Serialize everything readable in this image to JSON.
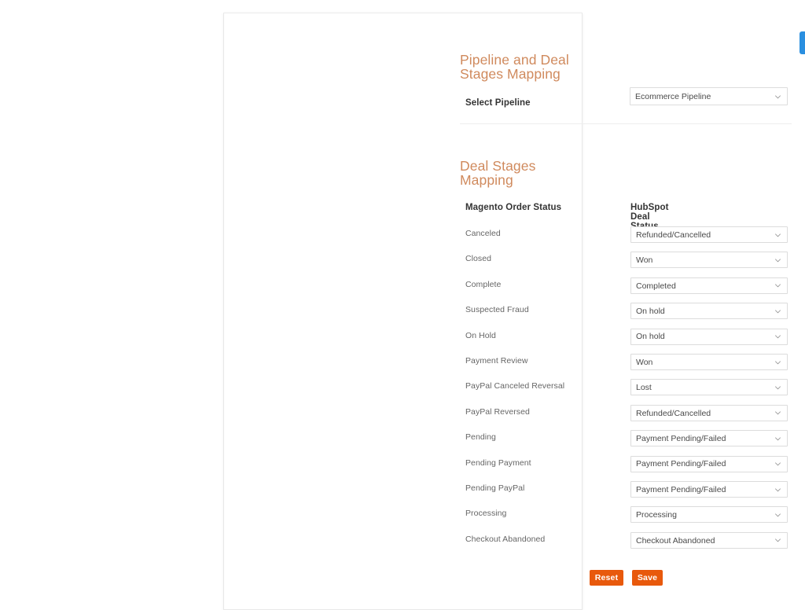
{
  "page": {
    "background": "#ffffff",
    "accent_heading_color": "#d08a5d",
    "button_color": "#e8590c",
    "edge_tab_color": "#2a8fe0"
  },
  "pipeline_section": {
    "title": "Pipeline and Deal Stages Mapping",
    "label": "Select Pipeline",
    "selected": "Ecommerce Pipeline"
  },
  "stages_section": {
    "title": "Deal Stages Mapping",
    "columns": {
      "magento": "Magento Order Status",
      "hubspot": "HubSpot Deal Status"
    },
    "rows": [
      {
        "status": "Canceled",
        "deal_status": "Refunded/Cancelled"
      },
      {
        "status": "Closed",
        "deal_status": "Won"
      },
      {
        "status": "Complete",
        "deal_status": "Completed"
      },
      {
        "status": "Suspected Fraud",
        "deal_status": "On hold"
      },
      {
        "status": "On Hold",
        "deal_status": "On hold"
      },
      {
        "status": "Payment Review",
        "deal_status": "Won"
      },
      {
        "status": "PayPal Canceled Reversal",
        "deal_status": "Lost"
      },
      {
        "status": "PayPal Reversed",
        "deal_status": "Refunded/Cancelled"
      },
      {
        "status": "Pending",
        "deal_status": "Payment Pending/Failed"
      },
      {
        "status": "Pending Payment",
        "deal_status": "Payment Pending/Failed"
      },
      {
        "status": "Pending PayPal",
        "deal_status": "Payment Pending/Failed"
      },
      {
        "status": "Processing",
        "deal_status": "Processing"
      },
      {
        "status": "Checkout Abandoned",
        "deal_status": "Checkout Abandoned"
      }
    ]
  },
  "actions": {
    "reset_label": "Reset",
    "save_label": "Save"
  }
}
